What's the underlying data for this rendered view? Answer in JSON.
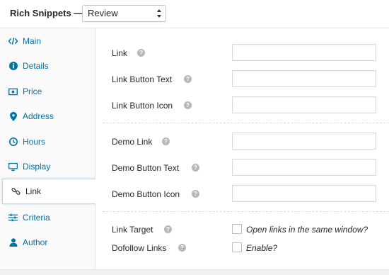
{
  "header": {
    "title": "Rich Snippets —",
    "type_select": {
      "value": "Review"
    }
  },
  "sidebar": {
    "items": [
      {
        "label": "Main",
        "icon": "code-icon"
      },
      {
        "label": "Details",
        "icon": "info-icon"
      },
      {
        "label": "Price",
        "icon": "money-icon"
      },
      {
        "label": "Address",
        "icon": "location-pin-icon"
      },
      {
        "label": "Hours",
        "icon": "clock-icon"
      },
      {
        "label": "Display",
        "icon": "monitor-icon"
      },
      {
        "label": "Link",
        "icon": "link-icon",
        "active": true
      },
      {
        "label": "Criteria",
        "icon": "sliders-icon"
      },
      {
        "label": "Author",
        "icon": "user-icon"
      }
    ]
  },
  "fields": {
    "link": {
      "label": "Link",
      "value": ""
    },
    "link_button_text": {
      "label": "Link Button Text",
      "value": ""
    },
    "link_button_icon": {
      "label": "Link Button Icon",
      "value": ""
    },
    "demo_link": {
      "label": "Demo Link",
      "value": ""
    },
    "demo_button_text": {
      "label": "Demo Button Text",
      "value": ""
    },
    "demo_button_icon": {
      "label": "Demo Button Icon",
      "value": ""
    },
    "link_target": {
      "label": "Link Target",
      "option": "Open links in the same window?",
      "checked": false
    },
    "dofollow_links": {
      "label": "Dofollow Links",
      "option": "Enable?",
      "checked": false
    }
  },
  "help_glyph": "?",
  "colors": {
    "link": "#0073aa",
    "active_border": "#c6d6e3",
    "help_icon": "#b4b9be"
  }
}
